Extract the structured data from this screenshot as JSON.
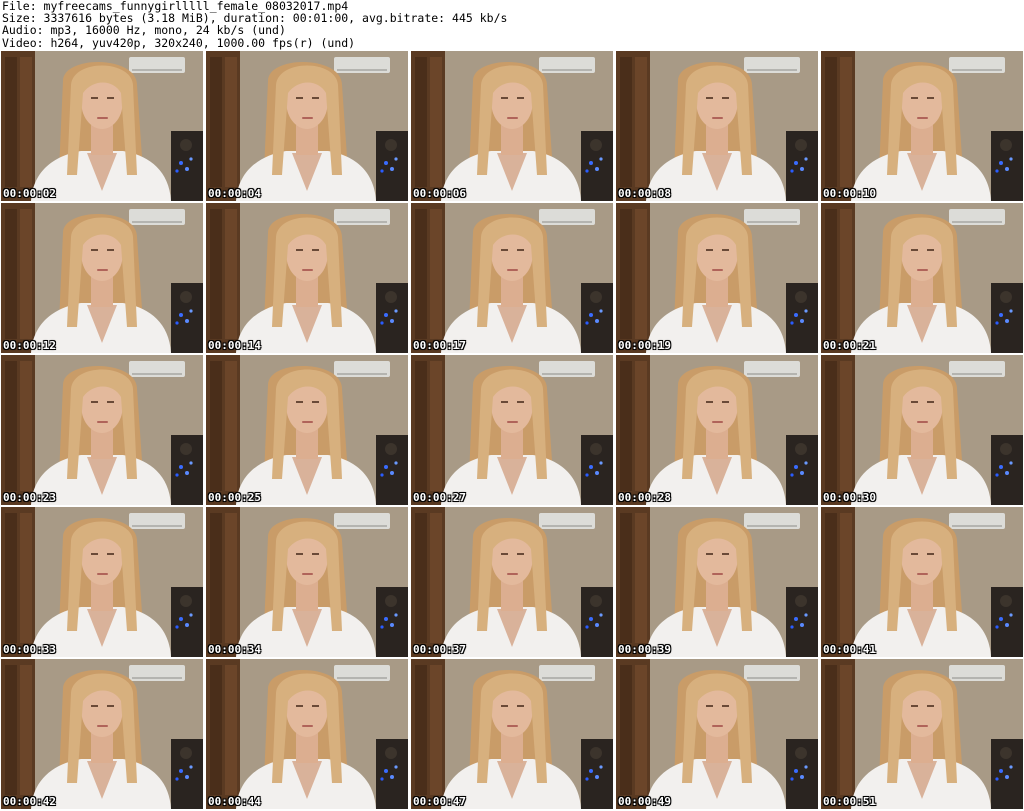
{
  "file_info": {
    "file": "File: myfreecams_funnygirlllll_female_08032017.mp4",
    "size": "Size: 3337616 bytes (3.18 MiB), duration: 00:01:00, avg.bitrate: 445 kb/s",
    "audio": "Audio: mp3, 16000 Hz, mono, 24 kb/s (und)",
    "video": "Video: h264, yuv420p, 320x240, 1000.00 fps(r) (und)"
  },
  "thumbnails": [
    {
      "timestamp": "00:00:02"
    },
    {
      "timestamp": "00:00:04"
    },
    {
      "timestamp": "00:00:06"
    },
    {
      "timestamp": "00:00:08"
    },
    {
      "timestamp": "00:00:10"
    },
    {
      "timestamp": "00:00:12"
    },
    {
      "timestamp": "00:00:14"
    },
    {
      "timestamp": "00:00:17"
    },
    {
      "timestamp": "00:00:19"
    },
    {
      "timestamp": "00:00:21"
    },
    {
      "timestamp": "00:00:23"
    },
    {
      "timestamp": "00:00:25"
    },
    {
      "timestamp": "00:00:27"
    },
    {
      "timestamp": "00:00:28"
    },
    {
      "timestamp": "00:00:30"
    },
    {
      "timestamp": "00:00:33"
    },
    {
      "timestamp": "00:00:34"
    },
    {
      "timestamp": "00:00:37"
    },
    {
      "timestamp": "00:00:39"
    },
    {
      "timestamp": "00:00:41"
    },
    {
      "timestamp": "00:00:42"
    },
    {
      "timestamp": "00:00:44"
    },
    {
      "timestamp": "00:00:47"
    },
    {
      "timestamp": "00:00:49"
    },
    {
      "timestamp": "00:00:51"
    }
  ],
  "colors": {
    "wall": "#a89a86",
    "door": "#5a3a22",
    "hair": "#d7b07e",
    "skin": "#e3b99c",
    "shirt": "#f2f0ee",
    "dark": "#2a2420",
    "blue_light": "#3a6cff"
  }
}
